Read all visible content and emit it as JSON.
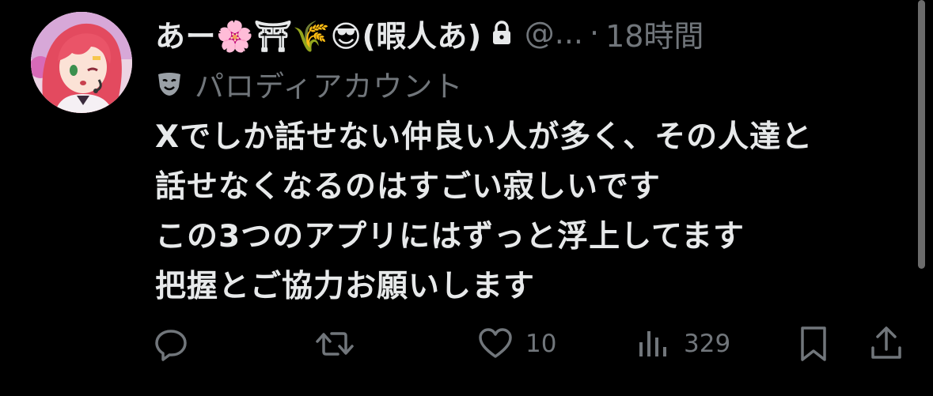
{
  "tweet": {
    "display_name": "あー🌸⛩🌾😎(暇人あ)",
    "handle": "@...",
    "separator": "·",
    "timestamp": "18時間",
    "parody_label": "パロディアカウント",
    "body_lines": [
      "Xでしか話せない仲良い人が多く、その人達と",
      "話せなくなるのはすごい寂しいです",
      "この3つのアプリにはずっと浮上してます",
      "把握とご協力お願いします"
    ]
  },
  "actions": {
    "reply": {
      "icon": "reply-icon",
      "count": ""
    },
    "repost": {
      "icon": "repost-icon",
      "count": ""
    },
    "like": {
      "icon": "heart-icon",
      "count": "10"
    },
    "views": {
      "icon": "views-icon",
      "count": "329"
    },
    "bookmark": {
      "icon": "bookmark-icon"
    },
    "share": {
      "icon": "share-icon"
    }
  },
  "colors": {
    "background": "#000000",
    "primary_text": "#e7e9ea",
    "secondary_text": "#71767b",
    "avatar_hair": "#e8475f"
  }
}
